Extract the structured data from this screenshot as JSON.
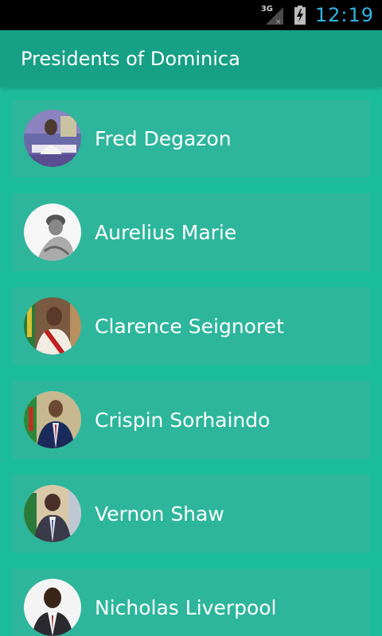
{
  "status_bar": {
    "network": "3G",
    "time": "12:19"
  },
  "app_bar": {
    "title": "Presidents of Dominica"
  },
  "presidents": [
    {
      "name": "Fred Degazon",
      "icon": "portrait"
    },
    {
      "name": "Aurelius Marie",
      "icon": "portrait"
    },
    {
      "name": "Clarence Seignoret",
      "icon": "portrait"
    },
    {
      "name": "Crispin Sorhaindo",
      "icon": "portrait"
    },
    {
      "name": "Vernon Shaw",
      "icon": "portrait"
    },
    {
      "name": "Nicholas Liverpool",
      "icon": "portrait"
    }
  ],
  "colors": {
    "background": "#1abc9c",
    "app_bar": "#16a085",
    "card": "#2db69b",
    "clock": "#33b5e5"
  }
}
